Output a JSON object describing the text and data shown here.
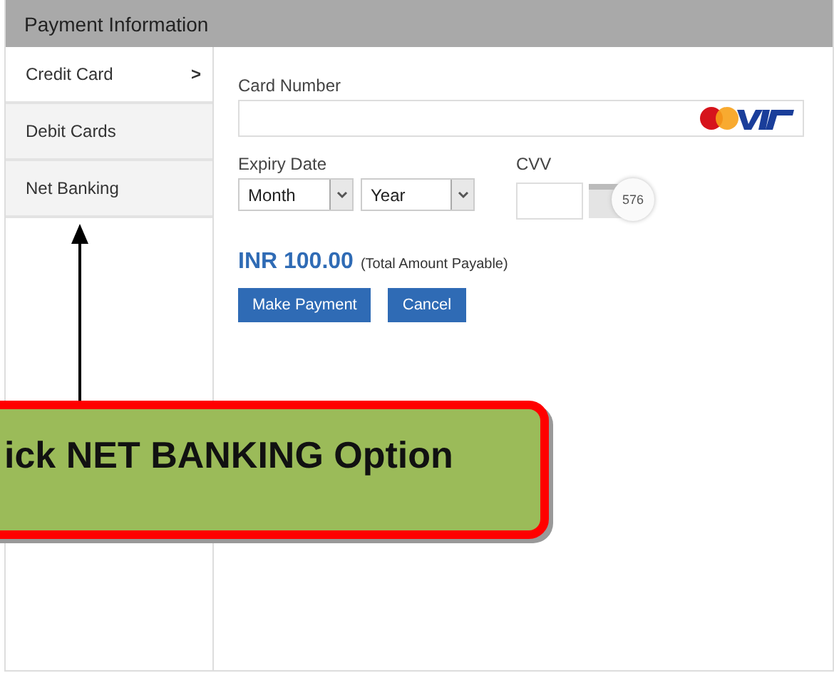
{
  "panel": {
    "title": "Payment Information"
  },
  "sidebar": {
    "items": [
      {
        "label": "Credit Card",
        "selected": true,
        "chevron": ">"
      },
      {
        "label": "Debit Cards",
        "selected": false
      },
      {
        "label": "Net Banking",
        "selected": false
      }
    ]
  },
  "form": {
    "card_number_label": "Card Number",
    "expiry_label": "Expiry Date",
    "month_value": "Month",
    "year_value": "Year",
    "cvv_label": "CVV",
    "cvv_hint": "576",
    "amount": "INR 100.00",
    "amount_note": "(Total Amount Payable)",
    "buttons": [
      "Make Payment",
      "Cancel"
    ]
  },
  "callout": {
    "text": "ick NET BANKING Option"
  }
}
